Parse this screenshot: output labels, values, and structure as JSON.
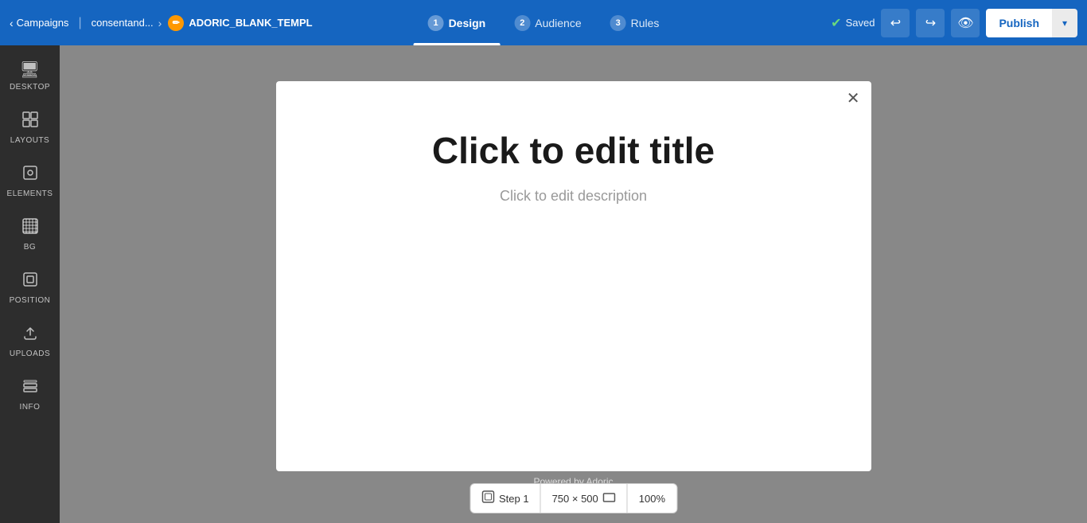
{
  "navbar": {
    "back_label": "Campaigns",
    "breadcrumb_label": "consentand...",
    "template_icon": "✏",
    "template_name": "ADORIC_BLANK_TEMPL",
    "tabs": [
      {
        "num": "1",
        "label": "Design",
        "active": true
      },
      {
        "num": "2",
        "label": "Audience",
        "active": false
      },
      {
        "num": "3",
        "label": "Rules",
        "active": false
      }
    ],
    "saved_label": "Saved",
    "undo_icon": "↩",
    "redo_icon": "↪",
    "preview_icon": "👁",
    "publish_label": "Publish",
    "dropdown_icon": "▾"
  },
  "sidebar": {
    "items": [
      {
        "id": "desktop",
        "icon": "🖥",
        "label": "DESKTOP"
      },
      {
        "id": "layouts",
        "icon": "⊞",
        "label": "LAYOUTS"
      },
      {
        "id": "elements",
        "icon": "◎",
        "label": "ELEMENTS"
      },
      {
        "id": "bg",
        "icon": "▦",
        "label": "BG"
      },
      {
        "id": "position",
        "icon": "⊡",
        "label": "POSITION"
      },
      {
        "id": "uploads",
        "icon": "⬆",
        "label": "UPLOADS"
      },
      {
        "id": "info",
        "icon": "⌨",
        "label": "INFO"
      }
    ]
  },
  "popup": {
    "title": "Click to edit title",
    "description": "Click to edit description",
    "close_icon": "✕"
  },
  "powered_by": "Powered by Adoric",
  "bottom_bar": {
    "step_icon": "⧉",
    "step_label": "Step 1",
    "size_label": "750 × 500",
    "size_icon": "▭",
    "zoom_label": "100%"
  }
}
